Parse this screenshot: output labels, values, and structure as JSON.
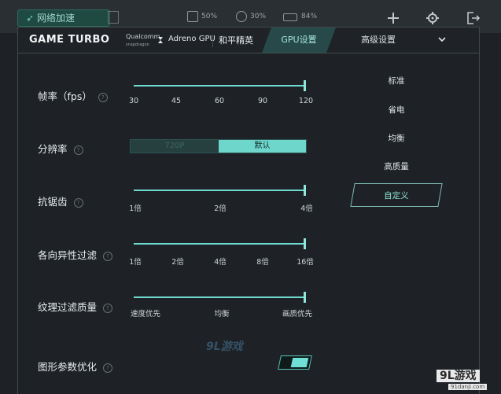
{
  "statusbar": {
    "network_boost_label": "网络加速",
    "cpu": "50%",
    "temperature": "30%",
    "battery": "84%"
  },
  "header": {
    "brand": "GAME TURBO",
    "chip_brand": "Qualcomm",
    "chip_sub": "snapdragon",
    "gpu_name": "Adreno GPU",
    "game_name": "和平精英",
    "tabs": [
      {
        "label": "GPU设置",
        "active": true
      },
      {
        "label": "高级设置",
        "active": false
      }
    ]
  },
  "settings": {
    "fps": {
      "label": "帧率（fps）",
      "ticks": [
        "30",
        "45",
        "60",
        "90",
        "120"
      ],
      "value": "120"
    },
    "resolution": {
      "label": "分辨率",
      "options": [
        "720P",
        "默认"
      ],
      "selected": "默认"
    },
    "antialiasing": {
      "label": "抗锯齿",
      "ticks": [
        "1倍",
        "2倍",
        "4倍"
      ],
      "value": "4倍"
    },
    "anisotropic": {
      "label": "各向异性过滤",
      "ticks": [
        "1倍",
        "2倍",
        "4倍",
        "8倍",
        "16倍"
      ],
      "value": "16倍"
    },
    "texture_quality": {
      "label": "纹理过滤质量",
      "ticks": [
        "速度优先",
        "均衡",
        "画质优先"
      ],
      "value": "画质优先"
    },
    "graphics_opt": {
      "label": "图形参数优化",
      "enabled": true
    }
  },
  "presets": {
    "items": [
      "标准",
      "省电",
      "均衡",
      "高质量",
      "自定义"
    ],
    "selected": "自定义"
  },
  "watermark": {
    "center": "9L游戏",
    "corner": "9L游戏",
    "corner_url": "91danji.com"
  },
  "colors": {
    "accent": "#6fdad0",
    "background": "#1e2226"
  }
}
